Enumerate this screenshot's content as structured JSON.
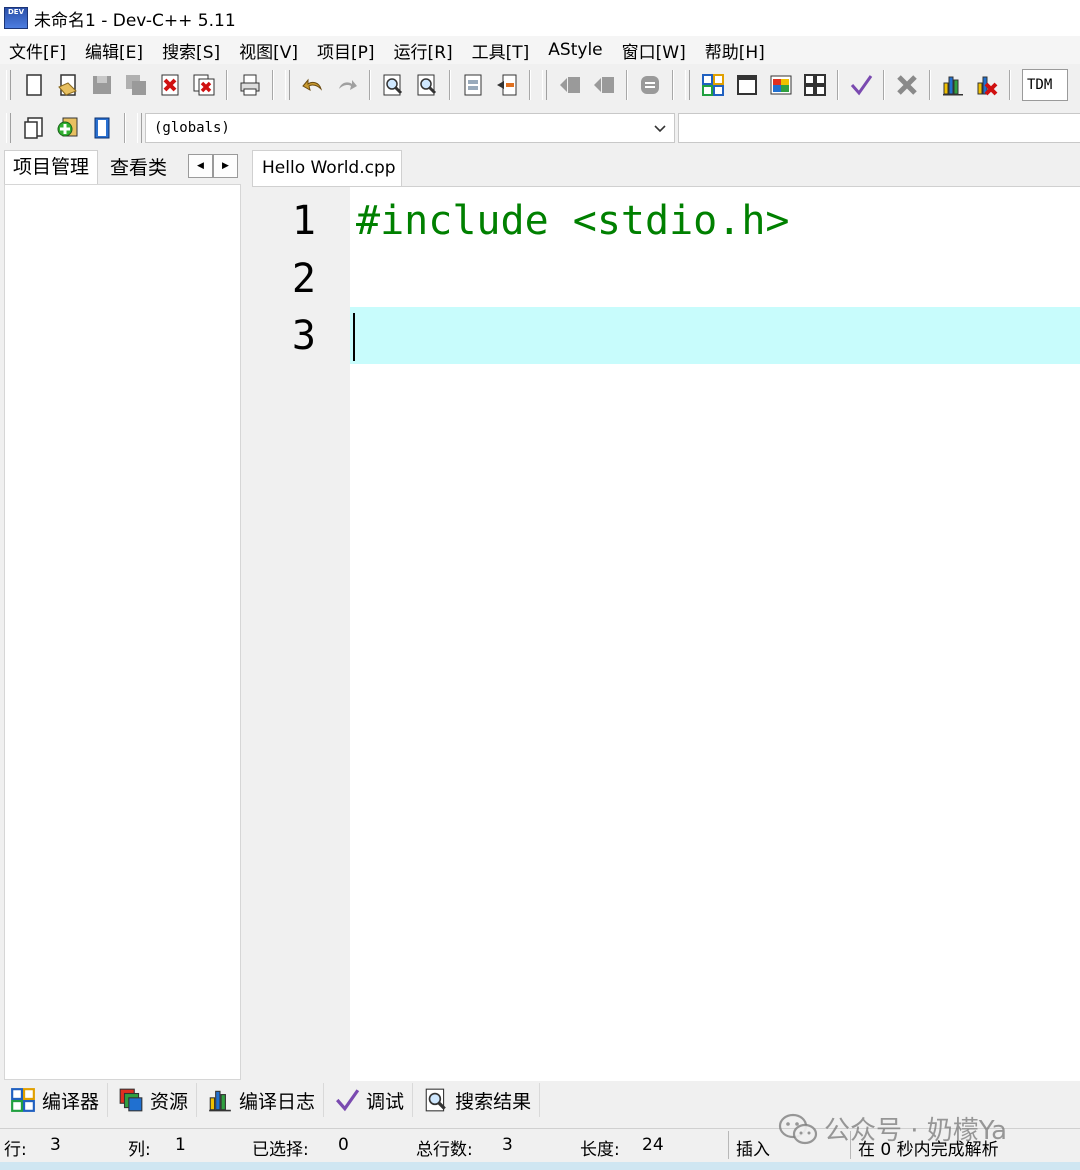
{
  "window": {
    "title": "未命名1 - Dev-C++ 5.11",
    "logo_text": "DEV"
  },
  "menu": [
    "文件[F]",
    "编辑[E]",
    "搜索[S]",
    "视图[V]",
    "项目[P]",
    "运行[R]",
    "工具[T]",
    "AStyle",
    "窗口[W]",
    "帮助[H]"
  ],
  "toolbar": {
    "compiler": "TDM"
  },
  "class_browser": {
    "scope": "(globals)",
    "member": ""
  },
  "left_panel": {
    "tabs": [
      "项目管理",
      "查看类"
    ]
  },
  "editor": {
    "file_tab": "Hello World.cpp",
    "lines": [
      {
        "number": "1",
        "code": "#include <stdio.h>"
      },
      {
        "number": "2",
        "code": ""
      },
      {
        "number": "3",
        "code": ""
      }
    ],
    "highlight_color": "#c8fcfc",
    "code_color": "#008000"
  },
  "bottom_tabs": [
    {
      "icon": "compiler-grid-icon",
      "label": "编译器"
    },
    {
      "icon": "resources-icon",
      "label": "资源"
    },
    {
      "icon": "compile-log-icon",
      "label": "编译日志"
    },
    {
      "icon": "debug-check-icon",
      "label": "调试"
    },
    {
      "icon": "search-results-icon",
      "label": "搜索结果"
    }
  ],
  "status": {
    "row_label": "行:",
    "row_value": "3",
    "col_label": "列:",
    "col_value": "1",
    "sel_label": "已选择:",
    "sel_value": "0",
    "total_label": "总行数:",
    "total_value": "3",
    "len_label": "长度:",
    "len_value": "24",
    "mode": "插入",
    "parse": "在 0 秒内完成解析"
  },
  "watermark": {
    "text": "公众号 · 奶檬Ya"
  }
}
